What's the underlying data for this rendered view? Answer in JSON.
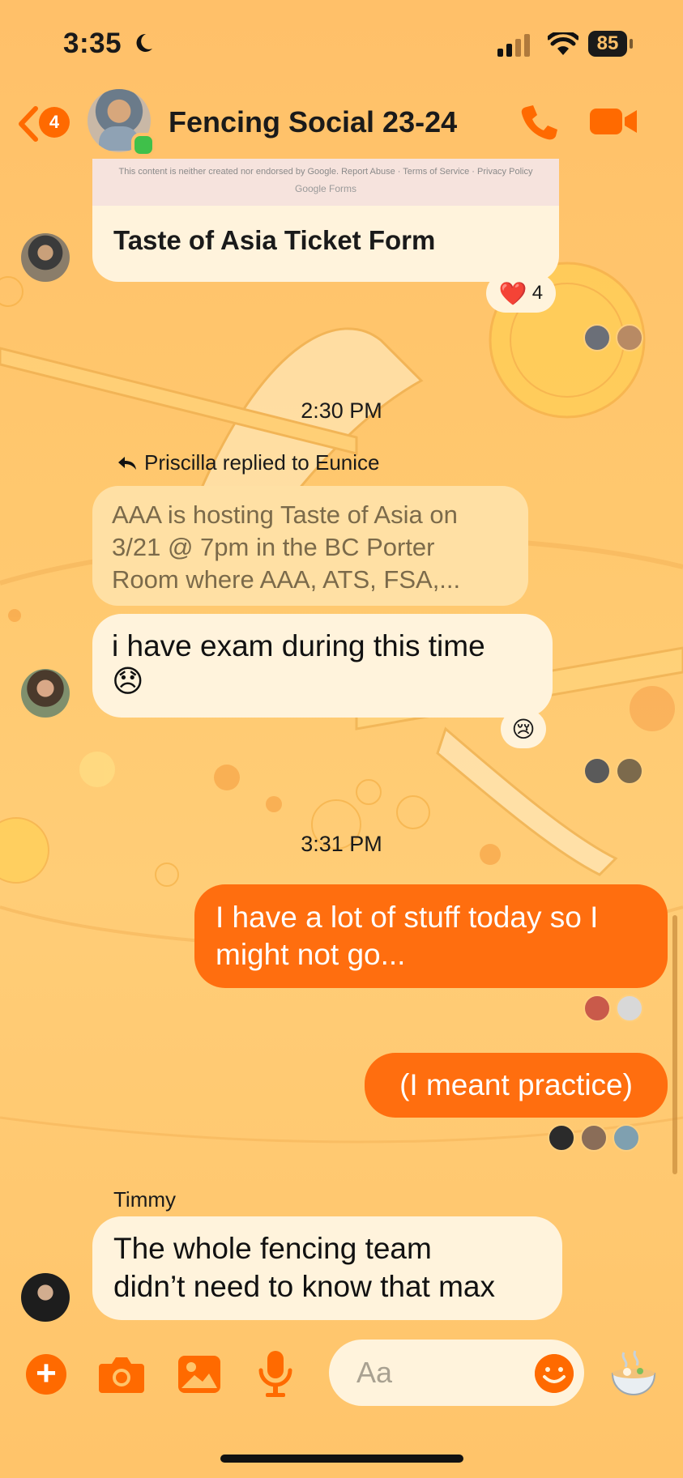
{
  "status_bar": {
    "time": "3:35",
    "battery": "85"
  },
  "header": {
    "unread_count": "4",
    "title": "Fencing Social 23-24"
  },
  "messages": {
    "link_card": {
      "preview_text": "This content is neither created nor endorsed by Google. Report Abuse · Terms of Service · Privacy Policy",
      "preview_brand": "Google Forms",
      "title": "Taste of Asia Ticket Form",
      "reaction_emoji": "❤️",
      "reaction_count": "4"
    },
    "time_1": "2:30 PM",
    "reply": {
      "label": "Priscilla replied to Eunice",
      "quoted_lines": [
        "AAA is hosting Taste of Asia on",
        "3/21 @ 7pm in the BC Porter",
        "Room where AAA, ATS, FSA,..."
      ],
      "text": "i have exam during this time",
      "emoji": "😞",
      "reaction_emoji": "😢"
    },
    "time_2": "3:31 PM",
    "out_1_lines": [
      "I have a lot of stuff today so I",
      "might not go..."
    ],
    "out_2": "(I meant practice)",
    "timmy": {
      "sender": "Timmy",
      "lines": [
        "The whole fencing team",
        "didn’t need to know that max"
      ]
    }
  },
  "composer": {
    "placeholder": "Aa"
  },
  "colors": {
    "accent": "#ff6e0f",
    "bubble_in": "#fff3dc",
    "background": "#ffc46a"
  }
}
